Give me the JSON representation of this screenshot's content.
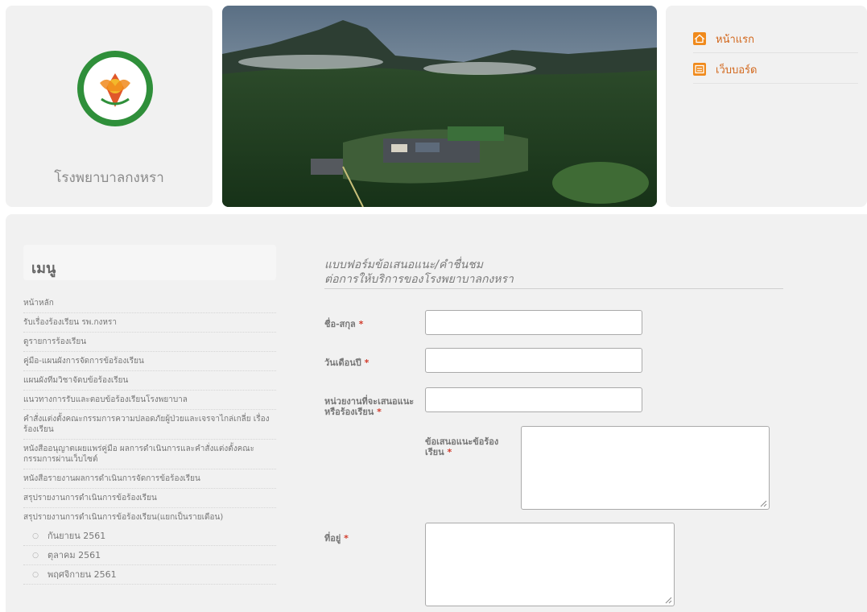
{
  "header": {
    "hospital_name": "โรงพยาบาลกงหรา",
    "nav": [
      {
        "label": "หน้าแรก",
        "icon": "home-icon"
      },
      {
        "label": "เว็บบอร์ด",
        "icon": "board-icon"
      }
    ]
  },
  "menu": {
    "title": "เมนู",
    "items": [
      "หน้าหลัก",
      "รับเรื่องร้องเรียน รพ.กงหรา",
      "ดูรายการร้องเรียน",
      "คู่มือ-แผนผังการจัดการข้อร้องเรียน",
      "แผนผังทีมวิชาจัดบข้อร้องเรียน",
      "แนวทางการรับและตอบข้อร้องเรียนโรงพยาบาล",
      "คำสั่งแต่งตั้งคณะกรรมการความปลอดภัยผู้ป่วยและเจรจาไกล่เกลี่ย เรื่องร้องเรียน",
      "หนังสืออนุญาตเผยแพร่คู่มือ ผลการดำเนินการและคำสั่งแต่งตั้งคณะกรรมการผ่านเว็บไซต์",
      "หนังสือรายงานผลการดำเนินการจัดการข้อร้องเรียน",
      "สรุปรายงานการดำเนินการข้อร้องเรียน",
      "สรุปรายงานการดำเนินการข้อร้องเรียน(แยกเป็นรายเดือน)"
    ],
    "sub_bullet": "○",
    "sub_items": [
      "กันยายน 2561",
      "ตุลาคม 2561",
      "พฤศจิกายน 2561"
    ]
  },
  "form": {
    "title_line1": "แบบฟอร์มข้อเสนอแนะ/คำชื่นชม",
    "title_line2": "ต่อการให้บริการของโรงพยาบาลกงหรา",
    "required_mark": "*",
    "fields": {
      "name": {
        "label": "ชื่อ-สกุล",
        "value": ""
      },
      "date": {
        "label": "วันเดือนปี",
        "value": ""
      },
      "department": {
        "label": "หน่วยงานที่จะเสนอแนะหรือร้องเรียน",
        "value": ""
      },
      "suggestion": {
        "label": "ข้อเสนอแนะข้อร้องเรียน",
        "value": ""
      },
      "address": {
        "label": "ที่อยู่",
        "value": ""
      }
    }
  },
  "colors": {
    "accent": "#f08a1c",
    "link": "#d2671c",
    "required": "#d23b2b",
    "seal_green": "#2f8f3a"
  }
}
